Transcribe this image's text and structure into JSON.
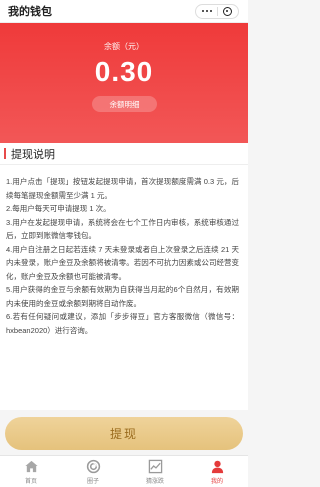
{
  "header": {
    "title": "我的钱包"
  },
  "balance": {
    "label": "余额（元）",
    "amount": "0.30",
    "detail_label": "余额明细"
  },
  "rules": {
    "title": "提现说明",
    "items": [
      "1.用户点击「提现」按钮发起提现申请，首次提现额度需满 0.3 元，后续每笔提现金额需至少满 1 元。",
      "2.每用户每天可申请提现 1 次。",
      "3.用户在发起提现申请，系统将会在七个工作日内审核，系统审核通过后，立即到账微信零钱包。",
      "4.用户自注册之日起若连续 7 天未登录或者自上次登录之后连续 21 天内未登录，账户金豆及余额将被清零。若因不可抗力因素或公司经营变化，账户金豆及余额也可能被清零。",
      "5.用户获得的金豆与余额有效期为自获得当月起的6个自然月，有效期内未使用的金豆或余额到期将自动作废。",
      "6.若有任何疑问或建议，添加「步步得豆」官方客服微信（微信号：hxbean2020）进行咨询。"
    ]
  },
  "withdraw_label": "提现",
  "tabs": [
    {
      "label": "首页",
      "icon": "home-icon",
      "active": false
    },
    {
      "label": "圈子",
      "icon": "circle-icon",
      "active": false
    },
    {
      "label": "猜涨跌",
      "icon": "chart-icon",
      "active": false
    },
    {
      "label": "我的",
      "icon": "user-icon",
      "active": true
    }
  ],
  "colors": {
    "brand_red": "#ef3a3a",
    "gold_button": "#e8c887",
    "active_tab": "#e43a3a"
  }
}
